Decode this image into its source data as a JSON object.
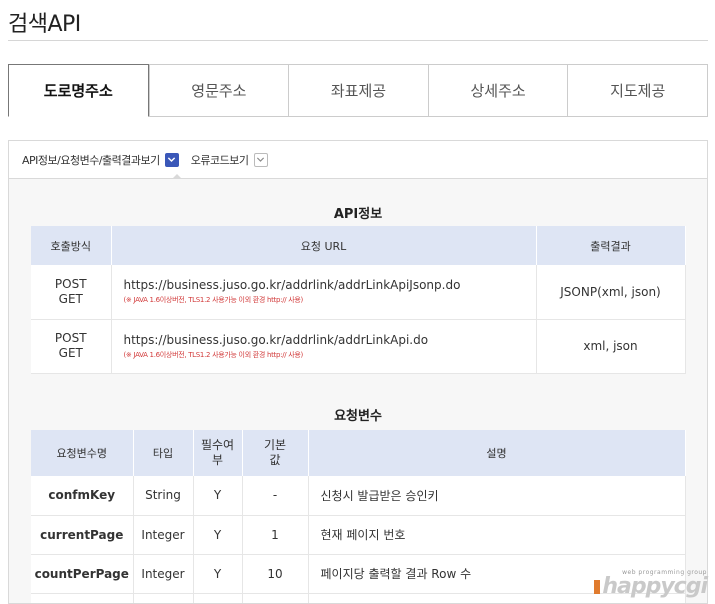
{
  "page": {
    "title": "검색API"
  },
  "tabs": [
    {
      "label": "도로명주소",
      "active": true
    },
    {
      "label": "영문주소",
      "active": false
    },
    {
      "label": "좌표제공",
      "active": false
    },
    {
      "label": "상세주소",
      "active": false
    },
    {
      "label": "지도제공",
      "active": false
    }
  ],
  "subnav": {
    "item1": "API정보/요청변수/출력결과보기",
    "item2": "오류코드보기"
  },
  "api_info": {
    "title": "API정보",
    "headers": [
      "호출방식",
      "요청 URL",
      "출력결과"
    ],
    "rows": [
      {
        "method1": "POST",
        "method2": "GET",
        "url": "https://business.juso.go.kr/addrlink/addrLinkApiJsonp.do",
        "note": "(※ JAVA 1.6이상버전, TLS1.2 사용가능 이외 환경 http:// 사용)",
        "output": "JSONP(xml, json)"
      },
      {
        "method1": "POST",
        "method2": "GET",
        "url": "https://business.juso.go.kr/addrlink/addrLinkApi.do",
        "note": "(※ JAVA 1.6이상버전, TLS1.2 사용가능 이외 환경 http:// 사용)",
        "output": "xml, json"
      }
    ]
  },
  "request_params": {
    "title": "요청변수",
    "headers": {
      "name": "요청변수명",
      "type": "타입",
      "required_1": "필수여",
      "required_2": "부",
      "default_1": "기본",
      "default_2": "값",
      "desc": "설명"
    },
    "rows": [
      {
        "name": "confmKey",
        "type": "String",
        "required": "Y",
        "default": "-",
        "desc": "신청시 발급받은 승인키"
      },
      {
        "name": "currentPage",
        "type": "Integer",
        "required": "Y",
        "default": "1",
        "desc": "현재 페이지 번호"
      },
      {
        "name": "countPerPage",
        "type": "Integer",
        "required": "Y",
        "default": "10",
        "desc": "페이지당 출력할 결과 Row 수"
      }
    ]
  },
  "watermark": {
    "small": "web programming group",
    "big": "happycgi"
  },
  "colors": {
    "accent": "#3a57b8",
    "header_bg": "#dee5f4",
    "note_red": "#d23b3b"
  }
}
